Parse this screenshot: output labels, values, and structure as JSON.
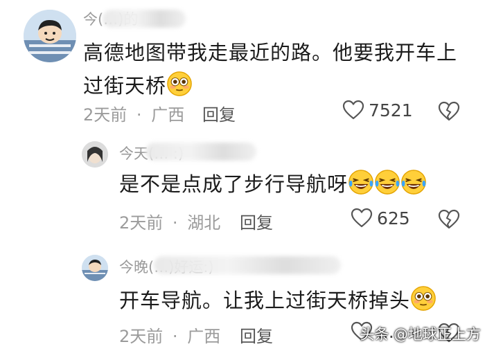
{
  "comments": [
    {
      "username": "今(…)的",
      "text_line1": "高德地图带我走最近的路。他要我开车上",
      "text_line2": "过街天桥",
      "emoji": "flushed-face",
      "time": "2天前",
      "sep": "·",
      "location": "广西",
      "reply_label": "回复",
      "likes": "7521"
    },
    {
      "username": "今天(… :)",
      "text": "是不是点成了步行导航呀",
      "emoji": "laughing-tears-face",
      "emoji_count": 3,
      "time": "2天前",
      "sep": "·",
      "location": "湖北",
      "reply_label": "回复",
      "likes": "625"
    },
    {
      "username": "今晚(…)好运:)",
      "text": "开车导航。让我上过街天桥掉头",
      "emoji": "flushed-face",
      "time": "2天前",
      "sep": "·",
      "location": "广西",
      "reply_label": "回复",
      "likes": "…"
    }
  ],
  "watermark": "头条 @地球正上方",
  "icons": {
    "like": "heart-outline-icon",
    "dislike": "broken-heart-icon"
  }
}
